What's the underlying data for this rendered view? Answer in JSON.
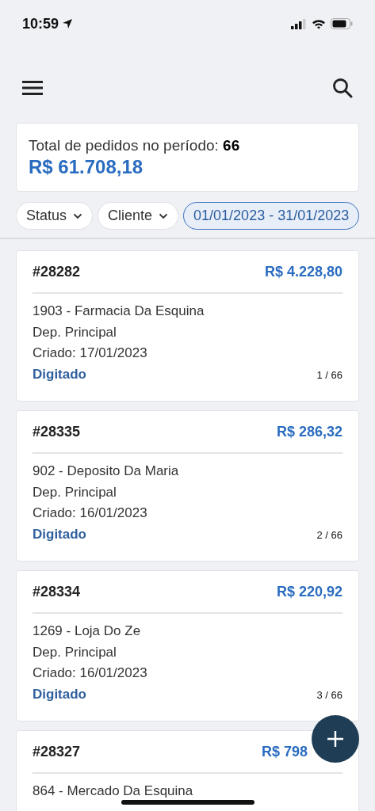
{
  "status_bar": {
    "time": "10:59"
  },
  "summary": {
    "label": "Total de pedidos no período: **66**",
    "total": "R$ 61.708,18"
  },
  "filters": [
    {
      "label": "Status",
      "kind": "dropdown",
      "selected": false
    },
    {
      "label": "Cliente",
      "kind": "dropdown",
      "selected": false
    },
    {
      "label": "01/01/2023 - 31/01/2023",
      "kind": "range",
      "selected": true
    }
  ],
  "orders": [
    {
      "number": "#28282",
      "amount": "R$ 4.228,80",
      "lines": [
        "1903 - Farmacia Da Esquina",
        "Dep. Principal",
        "Criado: 17/01/2023"
      ],
      "status": "Digitado",
      "position": "1 / 66"
    },
    {
      "number": "#28335",
      "amount": "R$ 286,32",
      "lines": [
        "902 - Deposito Da Maria",
        "Dep. Principal",
        "Criado: 16/01/2023"
      ],
      "status": "Digitado",
      "position": "2 / 66"
    },
    {
      "number": "#28334",
      "amount": "R$ 220,92",
      "lines": [
        "1269 - Loja Do Ze",
        "Dep. Principal",
        "Criado: 16/01/2023"
      ],
      "status": "Digitado",
      "position": "3 / 66"
    },
    {
      "number": "#28327",
      "amount": "R$ 798",
      "cut": true,
      "lines": [
        "864 - Mercado Da Esquina"
      ]
    }
  ]
}
